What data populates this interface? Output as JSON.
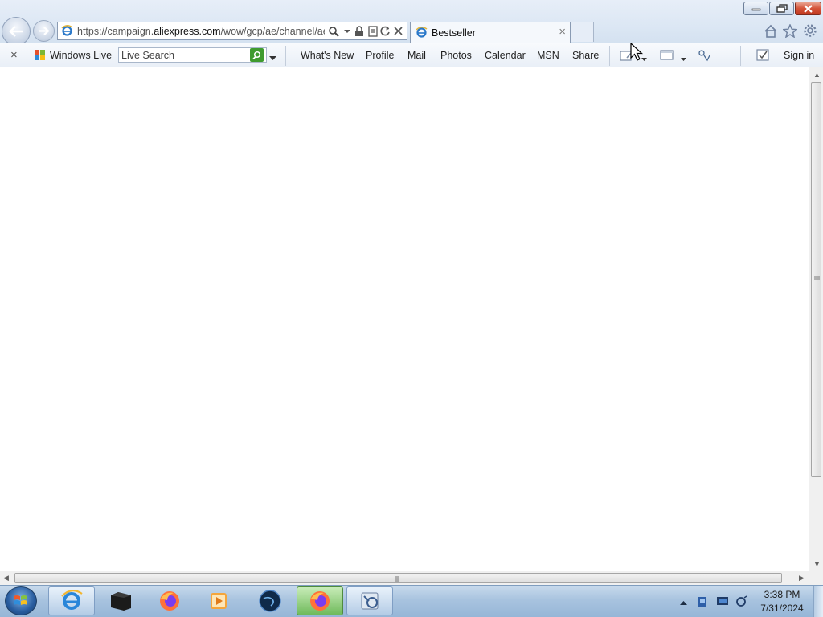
{
  "window": {
    "controls": {
      "minimize": "minimize",
      "restore": "restore",
      "close": "close"
    }
  },
  "nav": {
    "back_icon": "back-arrow-icon",
    "forward_icon": "forward-arrow-icon"
  },
  "address_bar": {
    "url_prefix": "https://campaign.",
    "url_host": "aliexpress.com",
    "url_path": "/wow/gcp/ae/channel/ae",
    "icons": [
      "search-icon",
      "dropdown-icon",
      "lock-icon",
      "compatibility-icon",
      "refresh-icon",
      "stop-icon"
    ]
  },
  "tabs": [
    {
      "title": "Bestseller",
      "active": true
    }
  ],
  "toolbar_right": [
    "home-icon",
    "favorites-star-icon",
    "tools-gear-icon"
  ],
  "live_toolbar": {
    "close_glyph": "×",
    "brand": "Windows Live",
    "search_placeholder": "Live Search",
    "links": [
      "What's New",
      "Profile",
      "Mail",
      "Photos",
      "Calendar",
      "MSN",
      "Share"
    ],
    "sign_in": "Sign in"
  },
  "taskbar": {
    "items": [
      {
        "name": "internet-explorer",
        "state": "pinned"
      },
      {
        "name": "terminal",
        "state": "normal"
      },
      {
        "name": "firefox",
        "state": "normal"
      },
      {
        "name": "media-player",
        "state": "normal"
      },
      {
        "name": "globe-app",
        "state": "normal"
      },
      {
        "name": "firefox-active",
        "state": "active"
      },
      {
        "name": "network-tool",
        "state": "pinned"
      }
    ],
    "clock": {
      "time": "3:38 PM",
      "date": "7/31/2024"
    }
  },
  "colors": {
    "chrome_bg": "#dce7f4",
    "taskbar": "#a8c3df",
    "live_search_go": "#3f9b2f",
    "close_red": "#c0381f"
  }
}
